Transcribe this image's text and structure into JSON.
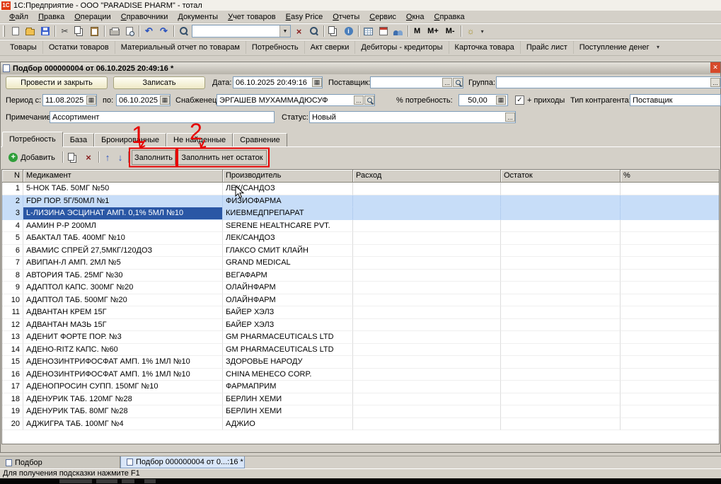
{
  "window": {
    "title": "1С:Предприятие - ООО \"PARADISE PHARM\" - тотал",
    "logo": "1С"
  },
  "menu": {
    "items": [
      "Файл",
      "Правка",
      "Операции",
      "Справочники",
      "Документы",
      "Учет товаров",
      "Easy Price",
      "Отчеты",
      "Сервис",
      "Окна",
      "Справка"
    ]
  },
  "toolbar1": {
    "memory": [
      "М",
      "М+",
      "М-"
    ],
    "search_value": ""
  },
  "toolbar2": {
    "items": [
      "Товары",
      "Остатки товаров",
      "Материальный отчет по товарам",
      "Потребность",
      "Акт сверки",
      "Дебиторы - кредиторы",
      "Карточка товара",
      "Прайс лист",
      "Поступление денег"
    ]
  },
  "doc": {
    "title": "Подбор 000000004 от 06.10.2025 20:49:16 *",
    "actions": {
      "post_close": "Провести и закрыть",
      "save": "Записать"
    },
    "fields": {
      "date_label": "Дата:",
      "date": "06.10.2025 20:49:16",
      "supplier_label": "Поставщик:",
      "supplier": "",
      "group_label": "Группа:",
      "group": "",
      "period_from_label": "Период с:",
      "period_from": "11.08.2025",
      "period_to_label": "по:",
      "period_to": "06.10.2025",
      "procurer_label": "Снабженец:",
      "procurer": "ЭРГАШЕВ МУХАММАДЮСУФ",
      "need_pct_label": "% потребность:",
      "need_pct": "50,00",
      "incoming_label": "+ приходы",
      "incoming_checked": true,
      "contragent_label": "Тип контрагента:",
      "contragent": "Поставщик",
      "note_label": "Примечание:",
      "note": "Ассортимент",
      "status_label": "Статус:",
      "status": "Новый"
    },
    "tabs": [
      {
        "label": "Потребность",
        "state": "active"
      },
      {
        "label": "База",
        "state": ""
      },
      {
        "label": "Бронированные",
        "state": ""
      },
      {
        "label": "Не найденные",
        "state": ""
      },
      {
        "label": "Сравнение",
        "state": ""
      }
    ],
    "toolbar": {
      "add": "Добавить",
      "fill": "Заполнить",
      "fill_no_stock": "Заполнить нет остаток"
    }
  },
  "table": {
    "headers": [
      "N",
      "Медикамент",
      "Производитель",
      "Расход",
      "Остаток",
      "%"
    ],
    "rows": [
      {
        "n": "1",
        "med": "5-НОК ТАБ. 50МГ №50",
        "mfr": "ЛЕК/САНДОЗ",
        "exp": "",
        "stock": "",
        "pct": "",
        "state": "",
        "med_state": ""
      },
      {
        "n": "2",
        "med": "FDP ПОР. 5Г/50МЛ №1",
        "mfr": "ФИЗИОФАРМА",
        "exp": "",
        "stock": "",
        "pct": "",
        "state": "selected",
        "med_state": ""
      },
      {
        "n": "3",
        "med": "L-ЛИЗИНА ЭСЦИНАТ АМП. 0,1% 5МЛ №10",
        "mfr": "КИЕВМЕДПРЕПАРАТ",
        "exp": "",
        "stock": "",
        "pct": "",
        "state": "selected",
        "med_state": "active"
      },
      {
        "n": "4",
        "med": "ААМИН Р-Р 200МЛ",
        "mfr": "SERENE HEALTHCARE PVT.",
        "exp": "",
        "stock": "",
        "pct": "",
        "state": "",
        "med_state": ""
      },
      {
        "n": "5",
        "med": "АБАКТАЛ ТАБ. 400МГ №10",
        "mfr": "ЛЕК/САНДОЗ",
        "exp": "",
        "stock": "",
        "pct": "",
        "state": "",
        "med_state": ""
      },
      {
        "n": "6",
        "med": "АВАМИС СПРЕЙ 27,5МКГ/120ДОЗ",
        "mfr": "ГЛАКСО СМИТ КЛАЙН",
        "exp": "",
        "stock": "",
        "pct": "",
        "state": "",
        "med_state": ""
      },
      {
        "n": "7",
        "med": "АВИПАН-Л АМП. 2МЛ №5",
        "mfr": "GRAND MEDICAL",
        "exp": "",
        "stock": "",
        "pct": "",
        "state": "",
        "med_state": ""
      },
      {
        "n": "8",
        "med": "АВТОРИЯ ТАБ. 25МГ №30",
        "mfr": "ВЕГАФАРМ",
        "exp": "",
        "stock": "",
        "pct": "",
        "state": "",
        "med_state": ""
      },
      {
        "n": "9",
        "med": "АДАПТОЛ КАПС. 300МГ №20",
        "mfr": "ОЛАЙНФАРМ",
        "exp": "",
        "stock": "",
        "pct": "",
        "state": "",
        "med_state": ""
      },
      {
        "n": "10",
        "med": "АДАПТОЛ ТАБ. 500МГ №20",
        "mfr": "ОЛАЙНФАРМ",
        "exp": "",
        "stock": "",
        "pct": "",
        "state": "",
        "med_state": ""
      },
      {
        "n": "11",
        "med": "АДВАНТАН КРЕМ 15Г",
        "mfr": "БАЙЕР ХЭЛЗ",
        "exp": "",
        "stock": "",
        "pct": "",
        "state": "",
        "med_state": ""
      },
      {
        "n": "12",
        "med": "АДВАНТАН МАЗЬ 15Г",
        "mfr": "БАЙЕР ХЭЛЗ",
        "exp": "",
        "stock": "",
        "pct": "",
        "state": "",
        "med_state": ""
      },
      {
        "n": "13",
        "med": "АДЕНИТ ФОРТЕ ПОР. №3",
        "mfr": "GM PHARMACEUTICALS LTD",
        "exp": "",
        "stock": "",
        "pct": "",
        "state": "",
        "med_state": ""
      },
      {
        "n": "14",
        "med": "АДЕНО-RITZ КАПС. №60",
        "mfr": "GM PHARMACEUTICALS LTD",
        "exp": "",
        "stock": "",
        "pct": "",
        "state": "",
        "med_state": ""
      },
      {
        "n": "15",
        "med": "АДЕНОЗИНТРИФОСФАТ АМП. 1% 1МЛ №10",
        "mfr": "ЗДОРОВЬЕ НАРОДУ",
        "exp": "",
        "stock": "",
        "pct": "",
        "state": "",
        "med_state": ""
      },
      {
        "n": "16",
        "med": "АДЕНОЗИНТРИФОСФАТ АМП. 1% 1МЛ №10",
        "mfr": "CHINA MEHECO CORP.",
        "exp": "",
        "stock": "",
        "pct": "",
        "state": "",
        "med_state": ""
      },
      {
        "n": "17",
        "med": "АДЕНОПРОСИН СУПП. 150МГ №10",
        "mfr": "ФАРМАПРИМ",
        "exp": "",
        "stock": "",
        "pct": "",
        "state": "",
        "med_state": ""
      },
      {
        "n": "18",
        "med": "АДЕНУРИК ТАБ. 120МГ №28",
        "mfr": "БЕРЛИН ХЕМИ",
        "exp": "",
        "stock": "",
        "pct": "",
        "state": "",
        "med_state": ""
      },
      {
        "n": "19",
        "med": "АДЕНУРИК ТАБ. 80МГ №28",
        "mfr": "БЕРЛИН ХЕМИ",
        "exp": "",
        "stock": "",
        "pct": "",
        "state": "",
        "med_state": ""
      },
      {
        "n": "20",
        "med": "АДЖИГРА ТАБ. 100МГ №4",
        "mfr": "АДЖИО",
        "exp": "",
        "stock": "",
        "pct": "",
        "state": "",
        "med_state": ""
      }
    ]
  },
  "annotations": {
    "labels": [
      "1",
      "2"
    ],
    "color": "#e60000"
  },
  "window_tabs": [
    {
      "label": "Подбор",
      "state": ""
    },
    {
      "label": "Подбор 000000004 от 0...:16 *",
      "state": "active"
    }
  ],
  "statusbar": {
    "hint": "Для получения подсказки нажмите F1"
  },
  "colors": {
    "row_selected": "#c7ddf8",
    "cell_active": "#2a57a5",
    "annotation": "#e60000",
    "chrome": "#d4d0c8"
  }
}
